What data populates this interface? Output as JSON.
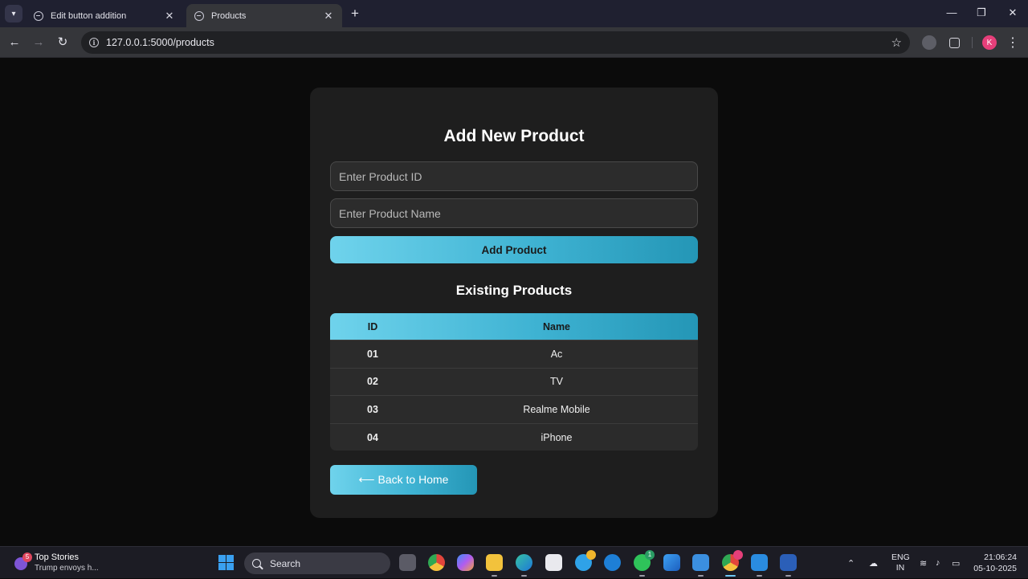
{
  "browser": {
    "tabs": [
      {
        "title": "Edit button addition",
        "active": false
      },
      {
        "title": "Products",
        "active": true
      }
    ],
    "url": "127.0.0.1:5000/products",
    "profile_initial": "K"
  },
  "page": {
    "form_title": "Add New Product",
    "id_placeholder": "Enter Product ID",
    "name_placeholder": "Enter Product Name",
    "add_button": "Add Product",
    "list_title": "Existing Products",
    "table": {
      "headers": {
        "id": "ID",
        "name": "Name"
      },
      "rows": [
        {
          "id": "01",
          "name": "Ac"
        },
        {
          "id": "02",
          "name": "TV"
        },
        {
          "id": "03",
          "name": "Realme Mobile"
        },
        {
          "id": "04",
          "name": "iPhone"
        }
      ]
    },
    "back_button": "⟵ Back to Home"
  },
  "taskbar": {
    "news_badge": "5",
    "news_title": "Top Stories",
    "news_subtitle": "Trump envoys h...",
    "search_label": "Search",
    "whatsapp_badge": "1",
    "language": "ENG",
    "region": "IN",
    "time": "21:06:24",
    "date": "05-10-2025"
  },
  "colors": {
    "accent_start": "#6fd3ec",
    "accent_end": "#2496b6",
    "card_bg": "#1e1e1e",
    "page_bg": "#0b0b0b"
  }
}
